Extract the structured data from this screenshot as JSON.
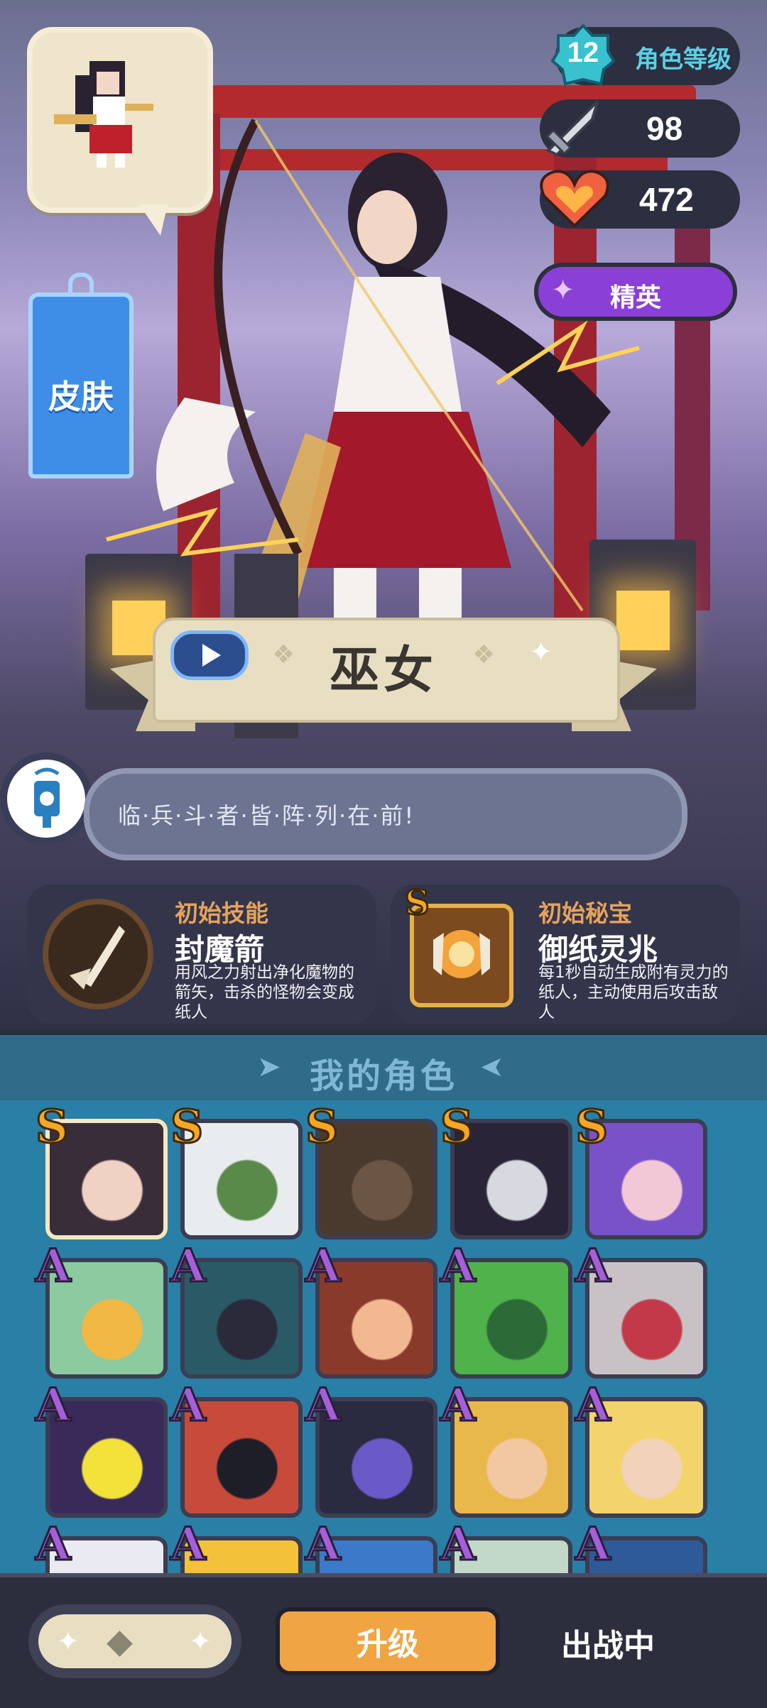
{
  "character": {
    "name": "巫女",
    "quote": "临·兵·斗·者·皆·阵·列·在·前!",
    "level": "12",
    "level_label": "角色等级",
    "attack": "98",
    "hp": "472",
    "rarity": "精英"
  },
  "skin_button": "皮肤",
  "skills": [
    {
      "sub": "初始技能",
      "title": "封魔箭",
      "desc": "用风之力射出净化魔物的箭矢，击杀的怪物会变成纸人"
    },
    {
      "sub": "初始秘宝",
      "grade": "S",
      "title": "御纸灵兆",
      "desc": "每1秒自动生成附有灵力的纸人，主动使用后攻击敌人"
    }
  ],
  "roster": {
    "title": "我的角色",
    "rows": [
      [
        "S",
        "S",
        "S",
        "S",
        "S"
      ],
      [
        "A",
        "A",
        "A",
        "A",
        "A"
      ],
      [
        "A",
        "A",
        "A",
        "A",
        "A"
      ],
      [
        "A",
        "A",
        "A",
        "A",
        "A"
      ]
    ]
  },
  "bottom": {
    "upgrade": "升级",
    "status": "出战中"
  },
  "colors": {
    "accent_orange": "#f0a443",
    "rarity_purple": "#8a3fd6",
    "grade_s": "#f5a623",
    "grade_a": "#a55fd8"
  }
}
